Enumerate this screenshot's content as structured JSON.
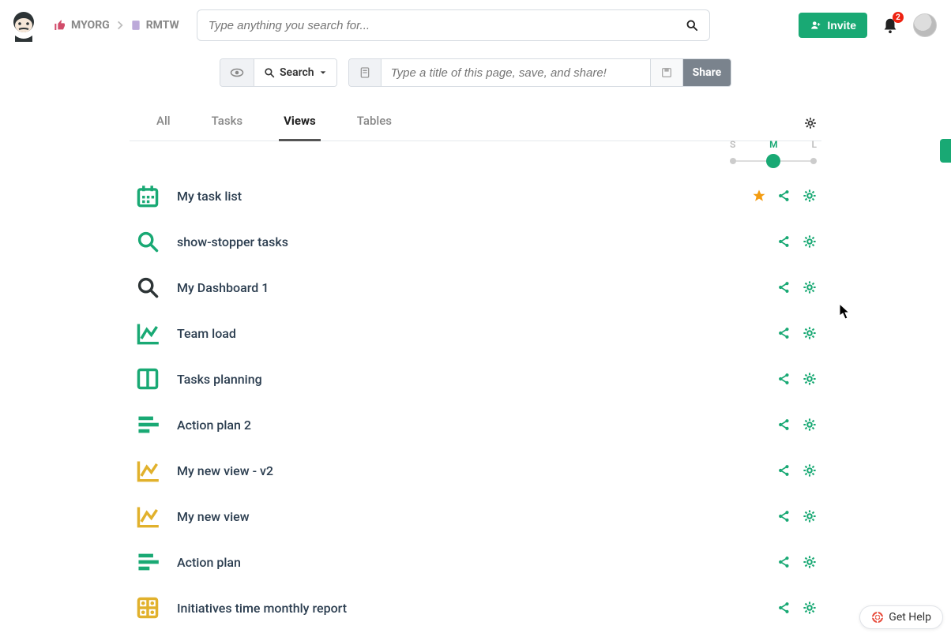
{
  "header": {
    "breadcrumb": {
      "org": "MYORG",
      "page": "RMTW"
    },
    "search_placeholder": "Type anything you search for...",
    "invite_label": "Invite",
    "notification_count": "2"
  },
  "toolbar": {
    "search_label": "Search",
    "title_placeholder": "Type a title of this page, save, and share!",
    "share_label": "Share"
  },
  "tabs": {
    "items": [
      "All",
      "Tasks",
      "Views",
      "Tables"
    ],
    "active": "Views"
  },
  "size_slider": {
    "labels": [
      "S",
      "M",
      "L"
    ],
    "value": "M"
  },
  "views": [
    {
      "icon": "calendar",
      "color": "green",
      "label": "My task list",
      "starred": true
    },
    {
      "icon": "search",
      "color": "green",
      "label": "show-stopper tasks",
      "starred": false
    },
    {
      "icon": "search",
      "color": "dark",
      "label": "My Dashboard 1",
      "starred": false
    },
    {
      "icon": "chart",
      "color": "green",
      "label": "Team load",
      "starred": false
    },
    {
      "icon": "columns",
      "color": "green",
      "label": "Tasks planning",
      "starred": false
    },
    {
      "icon": "lines",
      "color": "green",
      "label": "Action plan 2",
      "starred": false
    },
    {
      "icon": "chart",
      "color": "yellow",
      "label": "My new view - v2",
      "starred": false
    },
    {
      "icon": "chart",
      "color": "yellow",
      "label": "My new view",
      "starred": false
    },
    {
      "icon": "lines",
      "color": "green",
      "label": "Action plan",
      "starred": false
    },
    {
      "icon": "grid",
      "color": "yellow",
      "label": "Initiatives time monthly report",
      "starred": false
    }
  ],
  "help": {
    "label": "Get Help"
  }
}
